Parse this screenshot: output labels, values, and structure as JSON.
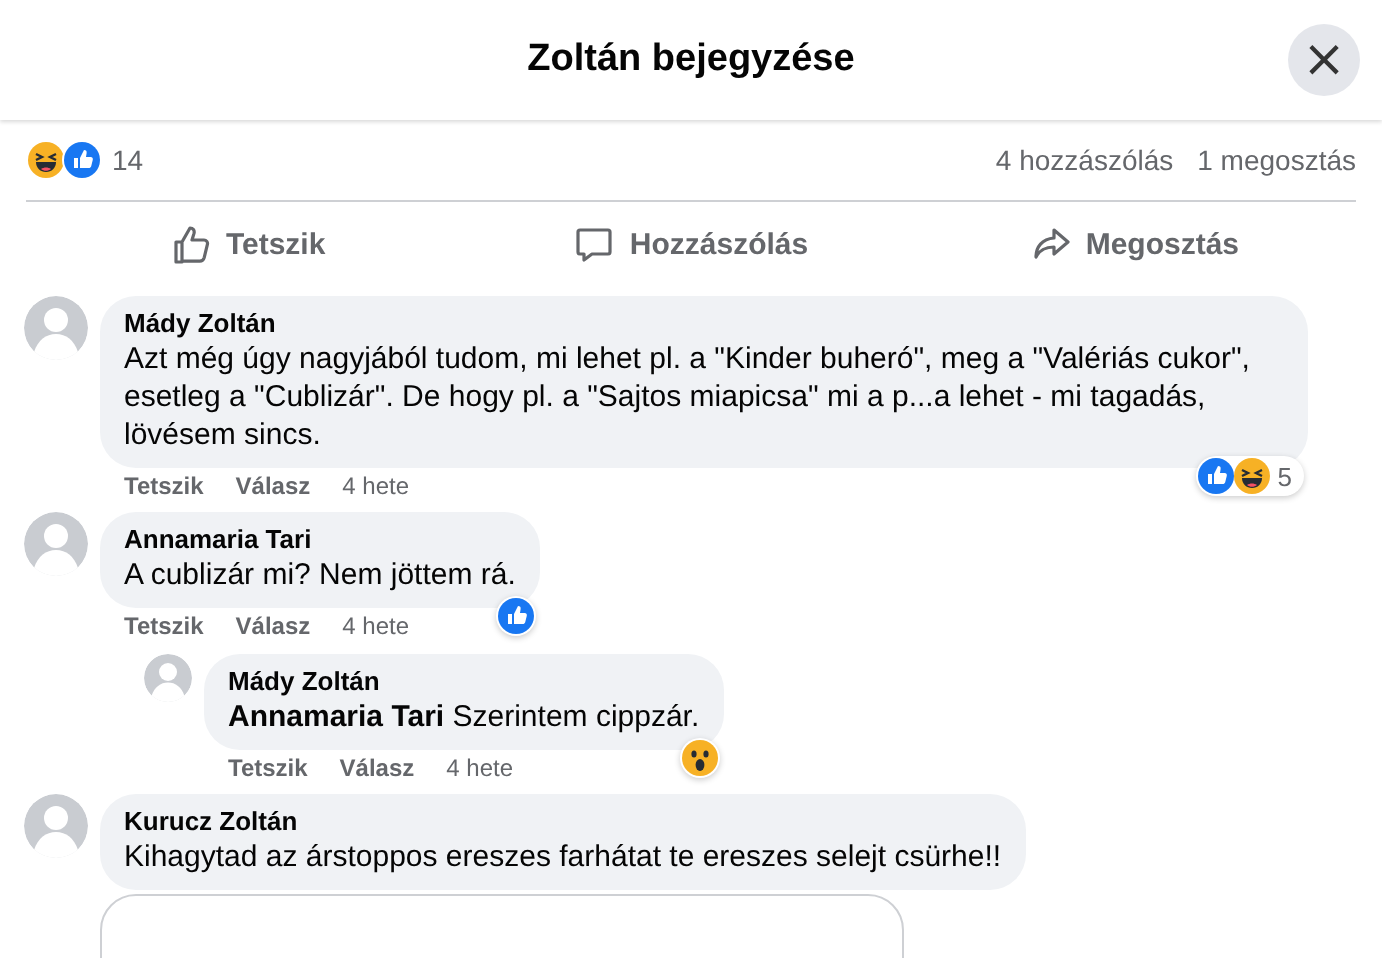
{
  "header": {
    "title": "Zoltán bejegyzése",
    "close": "×"
  },
  "stats": {
    "reactions": [
      {
        "kind": "haha"
      },
      {
        "kind": "like"
      }
    ],
    "count": "14",
    "comments": "4 hozzászólás",
    "shares": "1 megosztás"
  },
  "actions": [
    {
      "kind": "like",
      "label": "Tetszik"
    },
    {
      "kind": "comment",
      "label": "Hozzászólás"
    },
    {
      "kind": "share",
      "label": "Megosztás"
    }
  ],
  "comments": [
    {
      "author": "Mády Zoltán",
      "text": "Azt még úgy nagyjából tudom, mi lehet pl. a \"Kinder buheró\", meg a \"Valériás cukor\", esetleg a \"Cublizár\". De hogy pl. a \"Sajtos miapicsa\" mi a p...a lehet - mi tagadás, lövésem sincs.",
      "like": "Tetszik",
      "reply": "Válasz",
      "time": "4 hete",
      "reactions": [
        {
          "kind": "like"
        },
        {
          "kind": "haha"
        }
      ],
      "reaction_count": "5"
    },
    {
      "author": "Annamaria Tari",
      "text": "A cublizár mi? Nem jöttem rá.",
      "like": "Tetszik",
      "reply": "Válasz",
      "time": "4 hete",
      "reactions": [
        {
          "kind": "like"
        }
      ],
      "children": [
        {
          "author": "Mády Zoltán",
          "text": "**Annamaria Tari** Szerintem cippzár.",
          "like": "Tetszik",
          "reply": "Válasz",
          "time": "4 hete",
          "reactions": [
            {
              "kind": "wow"
            }
          ]
        }
      ]
    },
    {
      "author": "Kurucz Zoltán",
      "text": "Kihagytad az árstoppos ereszes farhátat te ereszes selejt csürhe!!",
      "attachment": {
        "kind": "card"
      }
    }
  ]
}
